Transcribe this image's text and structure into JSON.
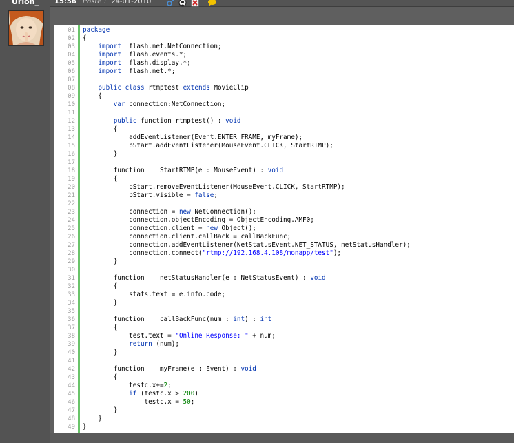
{
  "user": {
    "name": "Urion_"
  },
  "post": {
    "time": "15:56",
    "label": "Poste :",
    "date": "24-01-2010"
  },
  "header_icons": [
    {
      "name": "male-gender-icon",
      "color": "#4a8fd6"
    },
    {
      "name": "contact-card-icon",
      "color": "#222222"
    },
    {
      "name": "delete-report-icon",
      "color": "#d02020"
    },
    {
      "name": "quote-bubble-icon",
      "color": "#f2c200"
    }
  ],
  "code": {
    "lines": [
      [
        "01",
        [
          [
            "kw",
            "package"
          ]
        ]
      ],
      [
        "02",
        [
          [
            "t",
            "{"
          ]
        ]
      ],
      [
        "03",
        [
          [
            "t",
            "    "
          ],
          [
            "kw",
            "import"
          ],
          [
            "t",
            "  flash.net.NetConnection;"
          ]
        ]
      ],
      [
        "04",
        [
          [
            "t",
            "    "
          ],
          [
            "kw",
            "import"
          ],
          [
            "t",
            "  flash.events.*;"
          ]
        ]
      ],
      [
        "05",
        [
          [
            "t",
            "    "
          ],
          [
            "kw",
            "import"
          ],
          [
            "t",
            "  flash.display.*;"
          ]
        ]
      ],
      [
        "06",
        [
          [
            "t",
            "    "
          ],
          [
            "kw",
            "import"
          ],
          [
            "t",
            "  flash.net.*;"
          ]
        ]
      ],
      [
        "07",
        [
          [
            "t",
            ""
          ]
        ]
      ],
      [
        "08",
        [
          [
            "t",
            "    "
          ],
          [
            "kw",
            "public"
          ],
          [
            "t",
            " "
          ],
          [
            "kw",
            "class"
          ],
          [
            "t",
            " rtmptest "
          ],
          [
            "kw",
            "extends"
          ],
          [
            "t",
            " MovieClip"
          ]
        ]
      ],
      [
        "09",
        [
          [
            "t",
            "    {"
          ]
        ]
      ],
      [
        "10",
        [
          [
            "t",
            "        "
          ],
          [
            "kw",
            "var"
          ],
          [
            "t",
            " connection:NetConnection;"
          ]
        ]
      ],
      [
        "11",
        [
          [
            "t",
            ""
          ]
        ]
      ],
      [
        "12",
        [
          [
            "t",
            "        "
          ],
          [
            "kw",
            "public"
          ],
          [
            "t",
            " function rtmptest() : "
          ],
          [
            "kw",
            "void"
          ]
        ]
      ],
      [
        "13",
        [
          [
            "t",
            "        {"
          ]
        ]
      ],
      [
        "14",
        [
          [
            "t",
            "            addEventListener(Event.ENTER_FRAME, myFrame);"
          ]
        ]
      ],
      [
        "15",
        [
          [
            "t",
            "            bStart.addEventListener(MouseEvent.CLICK, StartRTMP);"
          ]
        ]
      ],
      [
        "16",
        [
          [
            "t",
            "        }"
          ]
        ]
      ],
      [
        "17",
        [
          [
            "t",
            ""
          ]
        ]
      ],
      [
        "18",
        [
          [
            "t",
            "        function    StartRTMP(e : MouseEvent) : "
          ],
          [
            "kw",
            "void"
          ]
        ]
      ],
      [
        "19",
        [
          [
            "t",
            "        {"
          ]
        ]
      ],
      [
        "20",
        [
          [
            "t",
            "            bStart.removeEventListener(MouseEvent.CLICK, StartRTMP);"
          ]
        ]
      ],
      [
        "21",
        [
          [
            "t",
            "            bStart.visible = "
          ],
          [
            "kw",
            "false"
          ],
          [
            "t",
            ";"
          ]
        ]
      ],
      [
        "22",
        [
          [
            "t",
            ""
          ]
        ]
      ],
      [
        "23",
        [
          [
            "t",
            "            connection = "
          ],
          [
            "kw",
            "new"
          ],
          [
            "t",
            " NetConnection();"
          ]
        ]
      ],
      [
        "24",
        [
          [
            "t",
            "            connection.objectEncoding = ObjectEncoding.AMF0;"
          ]
        ]
      ],
      [
        "25",
        [
          [
            "t",
            "            connection.client = "
          ],
          [
            "kw",
            "new"
          ],
          [
            "t",
            " Object();"
          ]
        ]
      ],
      [
        "26",
        [
          [
            "t",
            "            connection.client.callBack = callBackFunc;"
          ]
        ]
      ],
      [
        "27",
        [
          [
            "t",
            "            connection.addEventListener(NetStatusEvent.NET_STATUS, netStatusHandler);"
          ]
        ]
      ],
      [
        "28",
        [
          [
            "t",
            "            connection.connect("
          ],
          [
            "str",
            "\"rtmp://192.168.4.108/monapp/test\""
          ],
          [
            "t",
            ");"
          ]
        ]
      ],
      [
        "29",
        [
          [
            "t",
            "        }"
          ]
        ]
      ],
      [
        "30",
        [
          [
            "t",
            ""
          ]
        ]
      ],
      [
        "31",
        [
          [
            "t",
            "        function    netStatusHandler(e : NetStatusEvent) : "
          ],
          [
            "kw",
            "void"
          ]
        ]
      ],
      [
        "32",
        [
          [
            "t",
            "        {"
          ]
        ]
      ],
      [
        "33",
        [
          [
            "t",
            "            stats.text = e.info.code;"
          ]
        ]
      ],
      [
        "34",
        [
          [
            "t",
            "        }"
          ]
        ]
      ],
      [
        "35",
        [
          [
            "t",
            ""
          ]
        ]
      ],
      [
        "36",
        [
          [
            "t",
            "        function    callBackFunc(num : "
          ],
          [
            "kw",
            "int"
          ],
          [
            "t",
            ") : "
          ],
          [
            "kw",
            "int"
          ]
        ]
      ],
      [
        "37",
        [
          [
            "t",
            "        {"
          ]
        ]
      ],
      [
        "38",
        [
          [
            "t",
            "            test.text = "
          ],
          [
            "str",
            "\"Online Response: \""
          ],
          [
            "t",
            " + num;"
          ]
        ]
      ],
      [
        "39",
        [
          [
            "t",
            "            "
          ],
          [
            "kw",
            "return"
          ],
          [
            "t",
            " (num);"
          ]
        ]
      ],
      [
        "40",
        [
          [
            "t",
            "        }"
          ]
        ]
      ],
      [
        "41",
        [
          [
            "t",
            ""
          ]
        ]
      ],
      [
        "42",
        [
          [
            "t",
            "        function    myFrame(e : Event) : "
          ],
          [
            "kw",
            "void"
          ]
        ]
      ],
      [
        "43",
        [
          [
            "t",
            "        {"
          ]
        ]
      ],
      [
        "44",
        [
          [
            "t",
            "            testc.x+="
          ],
          [
            "numlit",
            "2"
          ],
          [
            "t",
            ";"
          ]
        ]
      ],
      [
        "45",
        [
          [
            "t",
            "            "
          ],
          [
            "kw",
            "if"
          ],
          [
            "t",
            " (testc.x > "
          ],
          [
            "numlit",
            "200"
          ],
          [
            "t",
            ")"
          ]
        ]
      ],
      [
        "46",
        [
          [
            "t",
            "                testc.x = "
          ],
          [
            "numlit",
            "50"
          ],
          [
            "t",
            ";"
          ]
        ]
      ],
      [
        "47",
        [
          [
            "t",
            "        }"
          ]
        ]
      ],
      [
        "48",
        [
          [
            "t",
            "    }"
          ]
        ]
      ],
      [
        "49",
        [
          [
            "t",
            "}"
          ]
        ]
      ]
    ]
  }
}
